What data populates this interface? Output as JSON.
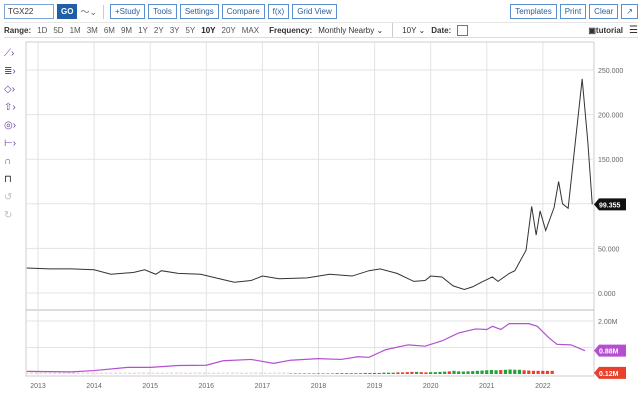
{
  "toolbar": {
    "symbol": "TGX22",
    "go": "GO",
    "buttons": [
      "+Study",
      "Tools",
      "Settings",
      "Compare",
      "f(x)",
      "Grid View"
    ],
    "right_buttons": [
      "Templates",
      "Print",
      "Clear"
    ]
  },
  "range": {
    "label": "Range:",
    "options": [
      "1D",
      "5D",
      "1M",
      "3M",
      "6M",
      "9M",
      "1Y",
      "2Y",
      "3Y",
      "5Y",
      "10Y",
      "20Y",
      "MAX"
    ],
    "selected": "10Y",
    "frequency_label": "Frequency:",
    "frequency": "Monthly Nearby",
    "period": "10Y",
    "date_label": "Date:",
    "tutorial": "tutorial"
  },
  "left_tools": [
    "draw-line-icon",
    "fib-icon",
    "shape-icon",
    "arrow-icon",
    "marker-icon",
    "measure-icon",
    "magnet-icon",
    "lock-icon",
    "undo-icon",
    "redo-icon"
  ],
  "chart_data": {
    "type": "line",
    "x_ticks": [
      "2013",
      "2014",
      "2015",
      "2016",
      "2017",
      "2018",
      "2019",
      "2020",
      "2021",
      "2022"
    ],
    "price": {
      "y_ticks": [
        "0.000",
        "50.000",
        "100.000",
        "150.000",
        "200.000",
        "250.000"
      ],
      "ylim": [
        0,
        250000
      ],
      "last_label": "99.355",
      "points": [
        [
          2012.8,
          28000
        ],
        [
          2013.2,
          27000
        ],
        [
          2013.6,
          27000
        ],
        [
          2014.0,
          26000
        ],
        [
          2014.3,
          21000
        ],
        [
          2014.7,
          23000
        ],
        [
          2014.9,
          26000
        ],
        [
          2015.1,
          21000
        ],
        [
          2015.2,
          25000
        ],
        [
          2015.5,
          22000
        ],
        [
          2015.9,
          21000
        ],
        [
          2016.3,
          15000
        ],
        [
          2016.5,
          12000
        ],
        [
          2016.8,
          14000
        ],
        [
          2017.0,
          19000
        ],
        [
          2017.3,
          16000
        ],
        [
          2017.8,
          17000
        ],
        [
          2018.2,
          21000
        ],
        [
          2018.6,
          19000
        ],
        [
          2018.9,
          25000
        ],
        [
          2019.1,
          27000
        ],
        [
          2019.4,
          22000
        ],
        [
          2019.7,
          13000
        ],
        [
          2019.9,
          14000
        ],
        [
          2020.0,
          19000
        ],
        [
          2020.2,
          18000
        ],
        [
          2020.4,
          8000
        ],
        [
          2020.6,
          4000
        ],
        [
          2020.75,
          7000
        ],
        [
          2020.9,
          12000
        ],
        [
          2021.1,
          18000
        ],
        [
          2021.2,
          13000
        ],
        [
          2021.4,
          22000
        ],
        [
          2021.5,
          25000
        ],
        [
          2021.7,
          48000
        ],
        [
          2021.8,
          97000
        ],
        [
          2021.88,
          65000
        ],
        [
          2021.95,
          92000
        ],
        [
          2022.05,
          70000
        ],
        [
          2022.2,
          96000
        ],
        [
          2022.28,
          125000
        ],
        [
          2022.35,
          100000
        ],
        [
          2022.45,
          95000
        ],
        [
          2022.7,
          240000
        ],
        [
          2022.8,
          170000
        ],
        [
          2022.88,
          99355
        ]
      ]
    },
    "open_interest": {
      "y_ticks": [
        "2.00M"
      ],
      "ylim": [
        0,
        2000000
      ],
      "last_label": "0.88M",
      "points": [
        [
          2012.8,
          0.1
        ],
        [
          2013.6,
          0.08
        ],
        [
          2014.0,
          0.13
        ],
        [
          2014.6,
          0.25
        ],
        [
          2015.0,
          0.25
        ],
        [
          2015.5,
          0.32
        ],
        [
          2016.0,
          0.33
        ],
        [
          2016.3,
          0.5
        ],
        [
          2016.8,
          0.55
        ],
        [
          2017.2,
          0.4
        ],
        [
          2017.5,
          0.52
        ],
        [
          2018.0,
          0.58
        ],
        [
          2018.4,
          0.55
        ],
        [
          2018.7,
          0.65
        ],
        [
          2018.9,
          0.63
        ],
        [
          2019.2,
          0.92
        ],
        [
          2019.6,
          1.1
        ],
        [
          2019.9,
          1.05
        ],
        [
          2020.2,
          1.25
        ],
        [
          2020.5,
          1.55
        ],
        [
          2020.8,
          1.7
        ],
        [
          2021.0,
          1.68
        ],
        [
          2021.1,
          1.8
        ],
        [
          2021.25,
          1.68
        ],
        [
          2021.4,
          1.9
        ],
        [
          2021.75,
          1.9
        ],
        [
          2021.9,
          1.8
        ],
        [
          2022.1,
          1.38
        ],
        [
          2022.25,
          1.12
        ],
        [
          2022.5,
          1.1
        ],
        [
          2022.75,
          0.88
        ]
      ]
    },
    "volume": {
      "last_label": "0.12M",
      "start": 2017.5,
      "step": 0.0833,
      "values": [
        0.02,
        0.02,
        0.02,
        0.02,
        0.02,
        0.02,
        0.02,
        0.02,
        0.02,
        0.02,
        0.03,
        0.03,
        0.03,
        0.03,
        0.03,
        0.03,
        0.04,
        0.04,
        0.04,
        0.04,
        0.05,
        0.05,
        0.05,
        0.06,
        0.06,
        0.07,
        0.08,
        0.08,
        0.07,
        0.06,
        0.07,
        0.07,
        0.08,
        0.09,
        0.1,
        0.12,
        0.1,
        0.09,
        0.1,
        0.11,
        0.12,
        0.13,
        0.14,
        0.15,
        0.14,
        0.15,
        0.16,
        0.17,
        0.16,
        0.16,
        0.14,
        0.13,
        0.12,
        0.12,
        0.12,
        0.12,
        0.12
      ],
      "up": [
        1,
        1,
        0,
        1,
        1,
        0,
        0,
        1,
        1,
        1,
        0,
        1,
        1,
        0,
        1,
        1,
        0,
        1,
        0,
        0,
        1,
        1,
        1,
        0,
        0,
        0,
        0,
        1,
        0,
        0,
        1,
        1,
        1,
        1,
        0,
        1,
        1,
        1,
        1,
        1,
        1,
        1,
        1,
        1,
        1,
        0,
        1,
        1,
        1,
        1,
        0,
        0,
        0,
        0,
        0,
        0,
        0
      ]
    },
    "colors": {
      "price": "#333333",
      "oi": "#b44fd1",
      "up": "#22a33a",
      "down": "#e8402a"
    }
  }
}
